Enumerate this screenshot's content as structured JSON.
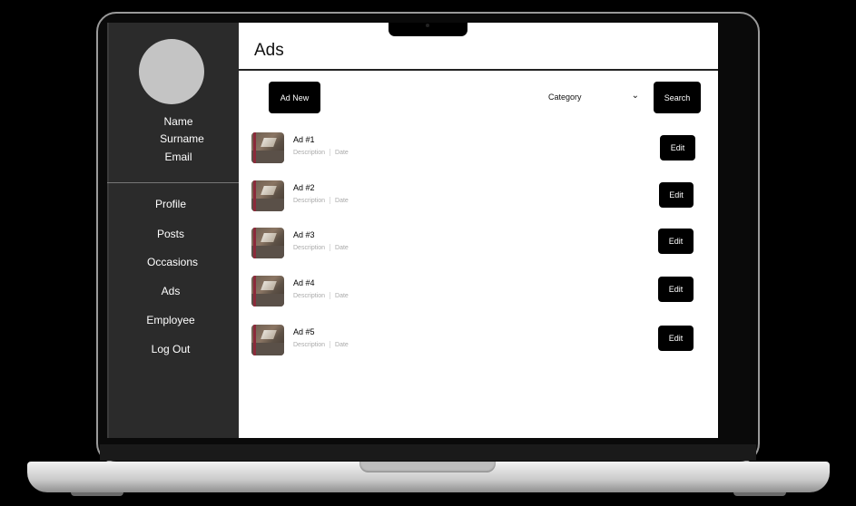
{
  "sidebar": {
    "profile": {
      "name": "Name",
      "surname": "Surname",
      "email": "Email"
    },
    "nav": [
      "Profile",
      "Posts",
      "Occasions",
      "Ads",
      "Employee",
      "Log Out"
    ]
  },
  "main": {
    "title": "Ads",
    "toolbar": {
      "add_label": "Ad New",
      "category_label": "Category",
      "category_icon": "chevron-down-icon",
      "search_label": "Search"
    },
    "ads": [
      {
        "title": "Ad #1",
        "description": "Description",
        "date": "Date",
        "edit_label": "Edit"
      },
      {
        "title": "Ad #2",
        "description": "Description",
        "date": "Date",
        "edit_label": "Edit"
      },
      {
        "title": "Ad #3",
        "description": "Description",
        "date": "Date",
        "edit_label": "Edit"
      },
      {
        "title": "Ad #4",
        "description": "Description",
        "date": "Date",
        "edit_label": "Edit"
      },
      {
        "title": "Ad #5",
        "description": "Description",
        "date": "Date",
        "edit_label": "Edit"
      }
    ]
  },
  "colors": {
    "sidebar_bg": "#2b2b2b",
    "button_bg": "#000000",
    "avatar": "#c4c4c4"
  }
}
